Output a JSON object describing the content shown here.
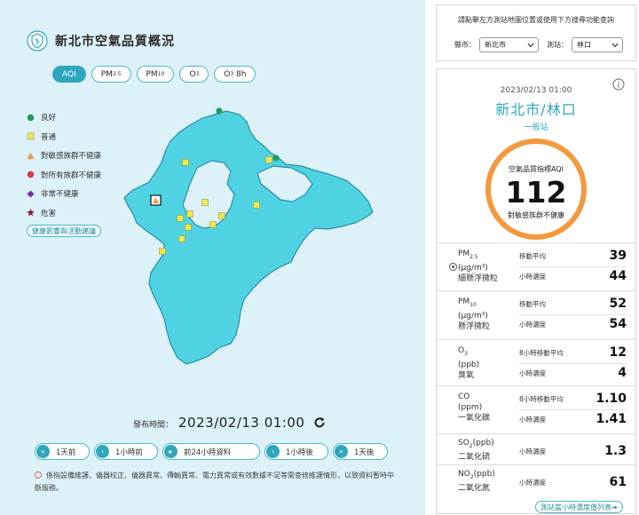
{
  "page": {
    "title": "新北市空氣品質概況"
  },
  "tabs": [
    {
      "main": "AQI",
      "sub": "",
      "active": true
    },
    {
      "main": "PM",
      "sub": "2.5",
      "active": false
    },
    {
      "main": "PM",
      "sub": "10",
      "active": false
    },
    {
      "main": "O",
      "sub": "3",
      "active": false
    },
    {
      "main": "O",
      "sub": "3",
      "suffix": " 8h",
      "active": false
    }
  ],
  "legend": [
    {
      "label": "良好",
      "shape": "circle",
      "color": "#1e9b5a"
    },
    {
      "label": "普通",
      "shape": "square",
      "color": "#f1e64b"
    },
    {
      "label": "對敏感族群不健康",
      "shape": "triangle",
      "color": "#f39a3e"
    },
    {
      "label": "對所有族群不健康",
      "shape": "circle",
      "color": "#e0344c"
    },
    {
      "label": "非常不健康",
      "shape": "diamond",
      "color": "#7b2fa0"
    },
    {
      "label": "危害",
      "shape": "star",
      "color": "#8a1f3c"
    }
  ],
  "health_link": "健康影響與活動建議",
  "publish": {
    "label": "發布時間：",
    "time": "2023/02/13 01:00"
  },
  "time_nav": [
    {
      "icon": "«",
      "label": "1天前"
    },
    {
      "icon": "‹",
      "label": "1小時前"
    },
    {
      "icon": "▸",
      "label": "前24小時資料"
    },
    {
      "icon": "›",
      "label": "1小時後"
    },
    {
      "icon": "»",
      "label": "1天後"
    }
  ],
  "disclaimer": "係指設備維護、儀器校正、儀器異常、傳輸異常、電力異常或有效數據不足等需查修維護情形，以致資料暫時中斷服務。",
  "search": {
    "hint": "請點擊左方測站地圖位置或使用下方搜尋功能查詢",
    "county_label": "縣市：",
    "county_value": "新北市",
    "station_label": "測站：",
    "station_value": "林口"
  },
  "station": {
    "obs_time": "2023/02/13 01:00",
    "name": "新北市/林口",
    "type": "一般站",
    "aqi_label": "空氣品質指標AQI",
    "aqi_value": "112",
    "aqi_status": "對敏感族群不健康",
    "ring_color": "#f39a3e"
  },
  "pollutants": [
    {
      "name_main": "PM",
      "name_sub": "2.5",
      "unit": "(μg/m³)",
      "desc": "細懸浮微粒",
      "rows": [
        {
          "label": "移動平均",
          "value": "39"
        },
        {
          "label": "小時濃度",
          "value": "44"
        }
      ]
    },
    {
      "name_main": "PM",
      "name_sub": "10",
      "unit": "(μg/m³)",
      "desc": "懸浮微粒",
      "rows": [
        {
          "label": "移動平均",
          "value": "52"
        },
        {
          "label": "小時濃度",
          "value": "54"
        }
      ]
    },
    {
      "name_main": "O",
      "name_sub": "3",
      "unit": "(ppb)",
      "desc": "臭氧",
      "rows": [
        {
          "label": "8小時移動平均",
          "value": "12"
        },
        {
          "label": "小時濃度",
          "value": "4"
        }
      ]
    },
    {
      "name_main": "CO",
      "name_sub": "",
      "unit": "(ppm)",
      "desc": "一氧化碳",
      "rows": [
        {
          "label": "8小時移動平均",
          "value": "1.10"
        },
        {
          "label": "小時濃度",
          "value": "1.41"
        }
      ]
    },
    {
      "name_main": "SO",
      "name_sub": "2",
      "unit": "(ppb)",
      "desc": "二氧化硫",
      "rows": [
        {
          "label": "小時濃度",
          "value": "1.3"
        }
      ]
    },
    {
      "name_main": "NO",
      "name_sub": "2",
      "unit": "(ppb)",
      "desc": "二氧化氮",
      "rows": [
        {
          "label": "小時濃度",
          "value": "61"
        }
      ]
    }
  ],
  "list_link": "測站當小時濃度值列表➔",
  "colors": {
    "accent": "#2fa7bd",
    "map_fill": "#4fd3e3",
    "panel_bg": "#dcf1f8",
    "good": "#1e9b5a",
    "moderate": "#f1e64b",
    "usg": "#f39a3e"
  },
  "map_stations": [
    {
      "status": "good"
    },
    {
      "status": "good"
    },
    {
      "status": "moderate"
    },
    {
      "status": "moderate"
    },
    {
      "status": "moderate"
    },
    {
      "status": "moderate"
    },
    {
      "status": "moderate"
    },
    {
      "status": "moderate"
    },
    {
      "status": "moderate"
    },
    {
      "status": "moderate"
    },
    {
      "status": "moderate"
    },
    {
      "status": "moderate"
    },
    {
      "status": "moderate"
    },
    {
      "status": "selected"
    }
  ]
}
